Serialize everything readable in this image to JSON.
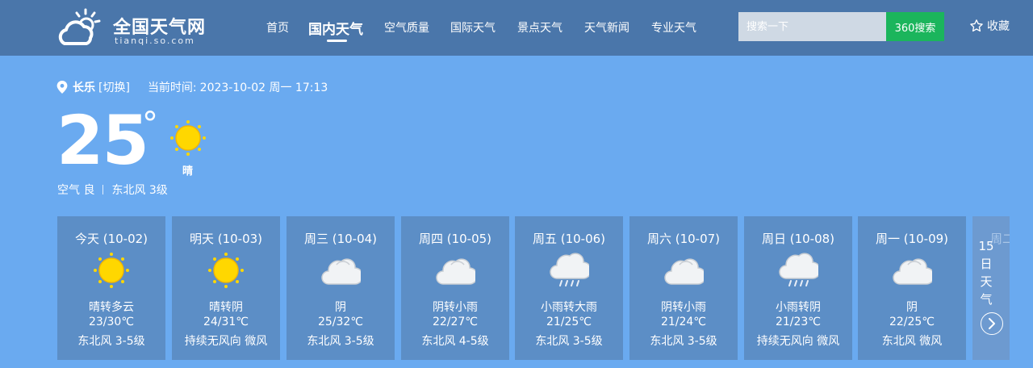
{
  "header": {
    "logo_title": "全国天气网",
    "logo_subtitle": "tianqi.so.com",
    "nav": [
      "首页",
      "国内天气",
      "空气质量",
      "国际天气",
      "景点天气",
      "天气新闻",
      "专业天气"
    ],
    "active_nav": "国内天气",
    "search_placeholder": "搜索一下",
    "search_button": "360搜索",
    "favorite_label": "收藏"
  },
  "current": {
    "city": "长乐",
    "switch_label": "[切换]",
    "time_label": "当前时间:",
    "time_value": "2023-10-02 周一 17:13",
    "temperature": "25",
    "degree": "°",
    "condition": "晴",
    "air_quality": "空气 良",
    "wind": "东北风 3级"
  },
  "forecast": [
    {
      "date": "今天 (10-02)",
      "icon": "sun-icon",
      "condition": "晴转多云",
      "temp": "23/30℃",
      "wind": "东北风 3-5级"
    },
    {
      "date": "明天 (10-03)",
      "icon": "sun-icon",
      "condition": "晴转阴",
      "temp": "24/31℃",
      "wind": "持续无风向 微风"
    },
    {
      "date": "周三 (10-04)",
      "icon": "cloud-icon",
      "condition": "阴",
      "temp": "25/32℃",
      "wind": "东北风 3-5级"
    },
    {
      "date": "周四 (10-05)",
      "icon": "cloud-icon",
      "condition": "阴转小雨",
      "temp": "22/27℃",
      "wind": "东北风 4-5级"
    },
    {
      "date": "周五 (10-06)",
      "icon": "rain-cloud-icon",
      "condition": "小雨转大雨",
      "temp": "21/25℃",
      "wind": "东北风 3-5级"
    },
    {
      "date": "周六 (10-07)",
      "icon": "cloud-icon",
      "condition": "阴转小雨",
      "temp": "21/24℃",
      "wind": "东北风 3-5级"
    },
    {
      "date": "周日 (10-08)",
      "icon": "rain-cloud-icon",
      "condition": "小雨转阴",
      "temp": "21/23℃",
      "wind": "持续无风向 微风"
    },
    {
      "date": "周一 (10-09)",
      "icon": "cloud-icon",
      "condition": "阴",
      "temp": "22/25℃",
      "wind": "东北风 微风"
    }
  ],
  "partial_card": {
    "date": "周二"
  },
  "fifteen_day": "15日天气",
  "colors": {
    "header_bg": "#4a76aa",
    "page_bg": "#6aaaf0",
    "card_bg": "#5c8ec6",
    "search_button_bg": "#1bb55c",
    "sun": "#ffd700"
  }
}
